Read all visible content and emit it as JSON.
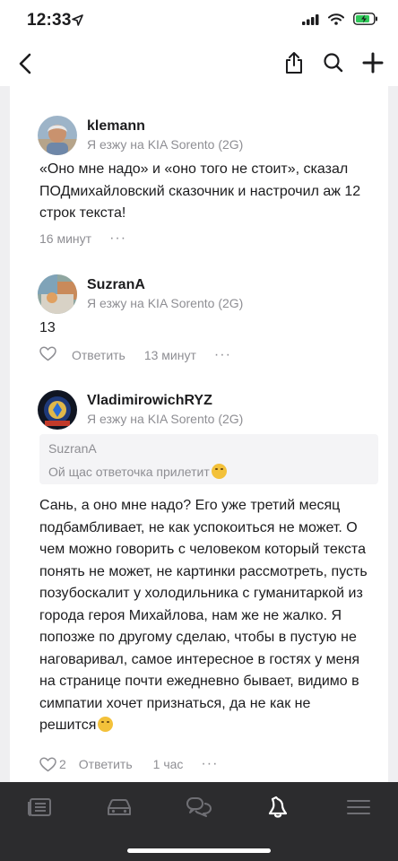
{
  "status": {
    "time": "12:33"
  },
  "nav": {
    "back": "back",
    "share": "share",
    "search": "search",
    "add": "add"
  },
  "comments": [
    {
      "author": "klemann",
      "car": "Я езжу на KIA Sorento (2G)",
      "text": "«Оно мне надо» и «оно того не стоит», сказал ПОДмихайловский сказочник и настрочил аж 12 строк текста!",
      "time": "16 минут",
      "more": "···"
    },
    {
      "author": "SuzranA",
      "car": "Я езжу на KIA Sorento (2G)",
      "text": "13",
      "reply": "Ответить",
      "time": "13 минут",
      "more": "···"
    },
    {
      "author": "VladimirowichRYZ",
      "car": "Я езжу на KIA Sorento (2G)",
      "quote_author": "SuzranA",
      "quote_text": "Ой щас ответочка прилетит",
      "text": "Сань, а оно мне надо? Его уже третий месяц подбамбливает, не как успокоиться не может. О чем можно говорить с человеком который текста понять не может, не картинки рассмотреть, пусть позубоскалит у холодильника с гуманитаркой из города героя Михайлова, нам же не жалко. Я попозже по другому сделаю, чтобы в пустую не наговаривал, самое интересное в гостях у меня на странице почти ежедневно бывает, видимо в симпатии хочет признаться, да не как не решится",
      "likes": "2",
      "reply": "Ответить",
      "time": "1 час",
      "more": "···"
    }
  ],
  "tabs": [
    "feed-icon",
    "car-icon",
    "chat-icon",
    "notifications-icon",
    "menu-icon"
  ],
  "colors": {
    "accent": "#1c1c1e",
    "secondary_text": "#8e8e93",
    "tabbar": "#2c2c2e",
    "tab_icon": "#6f6f74",
    "tab_active": "#ffffff"
  }
}
